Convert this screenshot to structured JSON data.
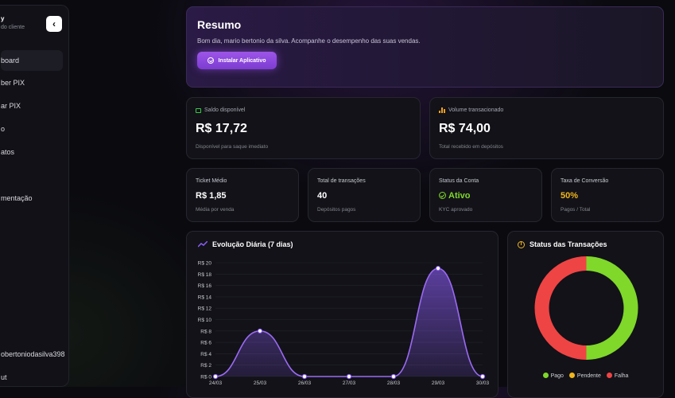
{
  "sidebar": {
    "brand_name": "y",
    "brand_sub": "do cliente",
    "items": [
      {
        "label": "board",
        "active": true
      },
      {
        "label": "ber PIX"
      },
      {
        "label": "ar PIX"
      },
      {
        "label": "o"
      },
      {
        "label": "atos"
      },
      {
        "label": "mentação"
      }
    ],
    "user": "obertoniodasilva398",
    "logout": "ut"
  },
  "summary": {
    "title": "Resumo",
    "greeting": "Bom dia, mario bertonio da silva. Acompanhe o desempenho das suas vendas.",
    "install_button": "Instalar Aplicativo"
  },
  "balance": {
    "label": "Saldo disponível",
    "value": "R$ 17,72",
    "note": "Disponível para saque imediato",
    "icon": "wallet-icon"
  },
  "volume": {
    "label": "Volume transacionado",
    "value": "R$ 74,00",
    "note": "Total recebido em depósitos",
    "icon": "bar-chart-icon"
  },
  "mini_cards": [
    {
      "label": "Ticket Médio",
      "value": "R$ 1,85",
      "note": "Média por venda"
    },
    {
      "label": "Total de transações",
      "value": "40",
      "note": "Depósitos pagos"
    },
    {
      "label": "Status da Conta",
      "value": "Ativo",
      "note": "KYC aprovado",
      "color": "#7fd82a"
    },
    {
      "label": "Taxa de Conversão",
      "value": "50%",
      "note": "Pagos / Total",
      "color": "#f2b61c"
    }
  ],
  "line_chart_title": "Evolução Diária (7 dias)",
  "status_chart_title": "Status das Transações",
  "chart_data": [
    {
      "type": "area",
      "title": "Evolução Diária (7 dias)",
      "categories": [
        "24/03",
        "25/03",
        "26/03",
        "27/03",
        "28/03",
        "29/03",
        "30/03"
      ],
      "values": [
        0,
        8,
        0,
        0,
        0,
        19,
        0
      ],
      "y_ticks": [
        "R$ 0",
        "R$ 2",
        "R$ 4",
        "R$ 6",
        "R$ 8",
        "R$ 10",
        "R$ 12",
        "R$ 14",
        "R$ 16",
        "R$ 18",
        "R$ 20"
      ],
      "ylim": [
        0,
        20
      ],
      "color": "#8b5cf6"
    },
    {
      "type": "pie",
      "title": "Status das Transações",
      "labels": [
        "Pago",
        "Pendente",
        "Falha"
      ],
      "values": [
        20,
        0,
        20
      ],
      "colors": [
        "#7fd82a",
        "#f2b61c",
        "#ef4444"
      ]
    }
  ]
}
